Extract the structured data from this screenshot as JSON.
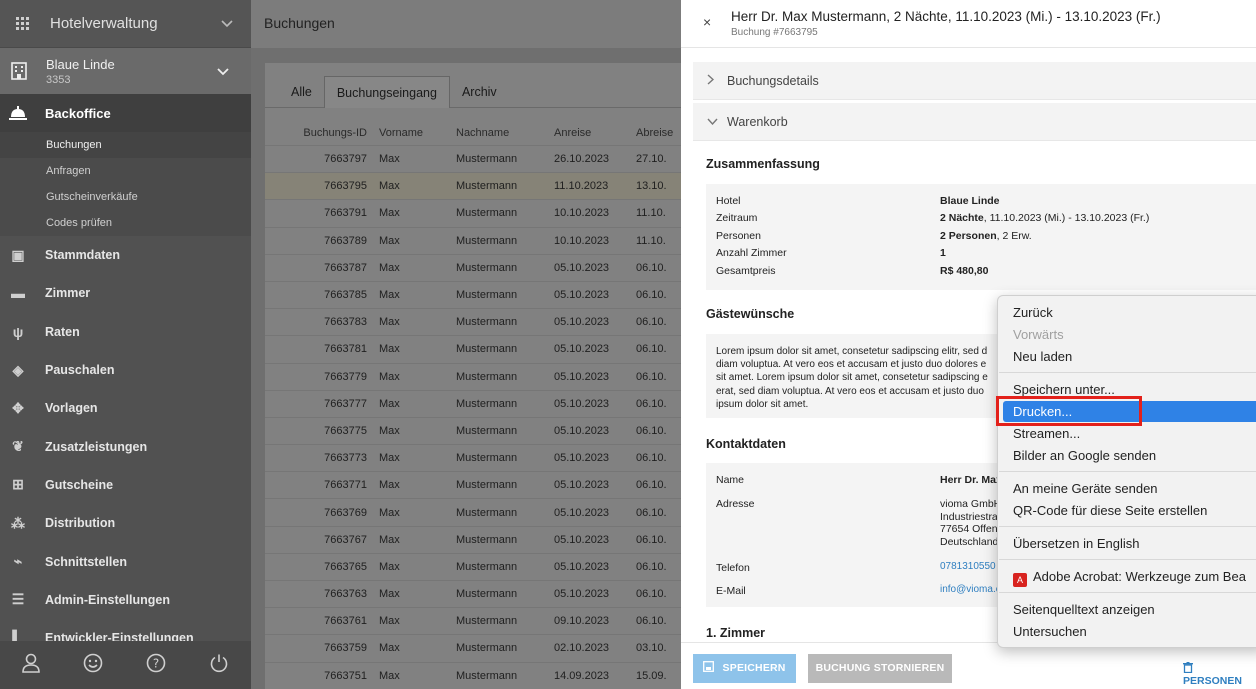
{
  "sidebar": {
    "app_title": "Hotelverwaltung",
    "hotel_name": "Blaue Linde",
    "hotel_id": "3353",
    "section": "Backoffice",
    "sub_items": [
      "Buchungen",
      "Anfragen",
      "Gutscheinverkäufe",
      "Codes prüfen"
    ],
    "items": [
      "Stammdaten",
      "Zimmer",
      "Raten",
      "Pauschalen",
      "Vorlagen",
      "Zusatzleistungen",
      "Gutscheine",
      "Distribution",
      "Schnittstellen",
      "Admin-Einstellungen",
      "Entwickler-Einstellungen"
    ]
  },
  "main": {
    "title": "Buchungen",
    "tabs": [
      "Alle",
      "Buchungseingang",
      "Archiv"
    ],
    "columns": [
      "Buchungs-ID",
      "Vorname",
      "Nachname",
      "Anreise",
      "Abreise"
    ],
    "rows": [
      [
        "7663797",
        "Max",
        "Mustermann",
        "26.10.2023",
        "27.10."
      ],
      [
        "7663795",
        "Max",
        "Mustermann",
        "11.10.2023",
        "13.10."
      ],
      [
        "7663791",
        "Max",
        "Mustermann",
        "10.10.2023",
        "11.10."
      ],
      [
        "7663789",
        "Max",
        "Mustermann",
        "10.10.2023",
        "11.10."
      ],
      [
        "7663787",
        "Max",
        "Mustermann",
        "05.10.2023",
        "06.10."
      ],
      [
        "7663785",
        "Max",
        "Mustermann",
        "05.10.2023",
        "06.10."
      ],
      [
        "7663783",
        "Max",
        "Mustermann",
        "05.10.2023",
        "06.10."
      ],
      [
        "7663781",
        "Max",
        "Mustermann",
        "05.10.2023",
        "06.10."
      ],
      [
        "7663779",
        "Max",
        "Mustermann",
        "05.10.2023",
        "06.10."
      ],
      [
        "7663777",
        "Max",
        "Mustermann",
        "05.10.2023",
        "06.10."
      ],
      [
        "7663775",
        "Max",
        "Mustermann",
        "05.10.2023",
        "06.10."
      ],
      [
        "7663773",
        "Max",
        "Mustermann",
        "05.10.2023",
        "06.10."
      ],
      [
        "7663771",
        "Max",
        "Mustermann",
        "05.10.2023",
        "06.10."
      ],
      [
        "7663769",
        "Max",
        "Mustermann",
        "05.10.2023",
        "06.10."
      ],
      [
        "7663767",
        "Max",
        "Mustermann",
        "05.10.2023",
        "06.10."
      ],
      [
        "7663765",
        "Max",
        "Mustermann",
        "05.10.2023",
        "06.10."
      ],
      [
        "7663763",
        "Max",
        "Mustermann",
        "05.10.2023",
        "06.10."
      ],
      [
        "7663761",
        "Max",
        "Mustermann",
        "09.10.2023",
        "06.10."
      ],
      [
        "7663759",
        "Max",
        "Mustermann",
        "02.10.2023",
        "03.10."
      ],
      [
        "7663751",
        "Max",
        "Mustermann",
        "14.09.2023",
        "15.09."
      ]
    ]
  },
  "panel": {
    "close": "×",
    "title": "Herr Dr. Max Mustermann, 2 Nächte, 11.10.2023 (Mi.) - 13.10.2023 (Fr.)",
    "subtitle": "Buchung #7663795",
    "acc_details": "Buchungsdetails",
    "acc_cart": "Warenkorb",
    "summary_title": "Zusammenfassung",
    "summary": {
      "hotel_label": "Hotel",
      "hotel_value": "Blaue Linde",
      "period_label": "Zeitraum",
      "period_bold": "2 Nächte",
      "period_rest": ", 11.10.2023 (Mi.) - 13.10.2023 (Fr.)",
      "persons_label": "Personen",
      "persons_bold": "2 Personen",
      "persons_rest": ", 2 Erw.",
      "rooms_label": "Anzahl Zimmer",
      "rooms_value": "1",
      "price_label": "Gesamtpreis",
      "price_value": "R$ 480,80"
    },
    "wishes_title": "Gästewünsche",
    "wishes_lines": [
      "Lorem ipsum dolor sit amet, consetetur sadipscing elitr, sed d",
      "diam voluptua. At vero eos et accusam et justo duo dolores e",
      "sit amet. Lorem ipsum dolor sit amet, consetetur sadipscing e",
      "erat, sed diam voluptua. At vero eos et accusam et justo duo",
      "ipsum dolor sit amet."
    ],
    "contact_title": "Kontaktdaten",
    "contact": {
      "name_label": "Name",
      "name_value": "Herr Dr. Max",
      "address_label": "Adresse",
      "address_lines": [
        "vioma GmbH",
        "Industriestra",
        "77654 Offenb",
        "Deutschland"
      ],
      "phone_label": "Telefon",
      "phone_value": "0781310550",
      "email_label": "E-Mail",
      "email_value": "info@vioma.c"
    },
    "room_title": "1. Zimmer",
    "save_button": "SPEICHERN",
    "cancel_button": "BUCHUNG STORNIEREN",
    "persons_button": "PERSONEN"
  },
  "context_menu": {
    "items": [
      "Zurück",
      "Vorwärts",
      "Neu laden",
      "Speichern unter...",
      "Drucken...",
      "Streamen...",
      "Bilder an Google senden",
      "An meine Geräte senden",
      "QR-Code für diese Seite erstellen",
      "Übersetzen in English",
      "Adobe Acrobat: Werkzeuge zum Bea",
      "Seitenquelltext anzeigen",
      "Untersuchen"
    ],
    "selected": "Drucken..."
  },
  "colors": {
    "accent": "#2f82e6",
    "highlight_box": "#e3211b",
    "save_button": "#8ec3ea",
    "link": "#2f7fc0"
  }
}
